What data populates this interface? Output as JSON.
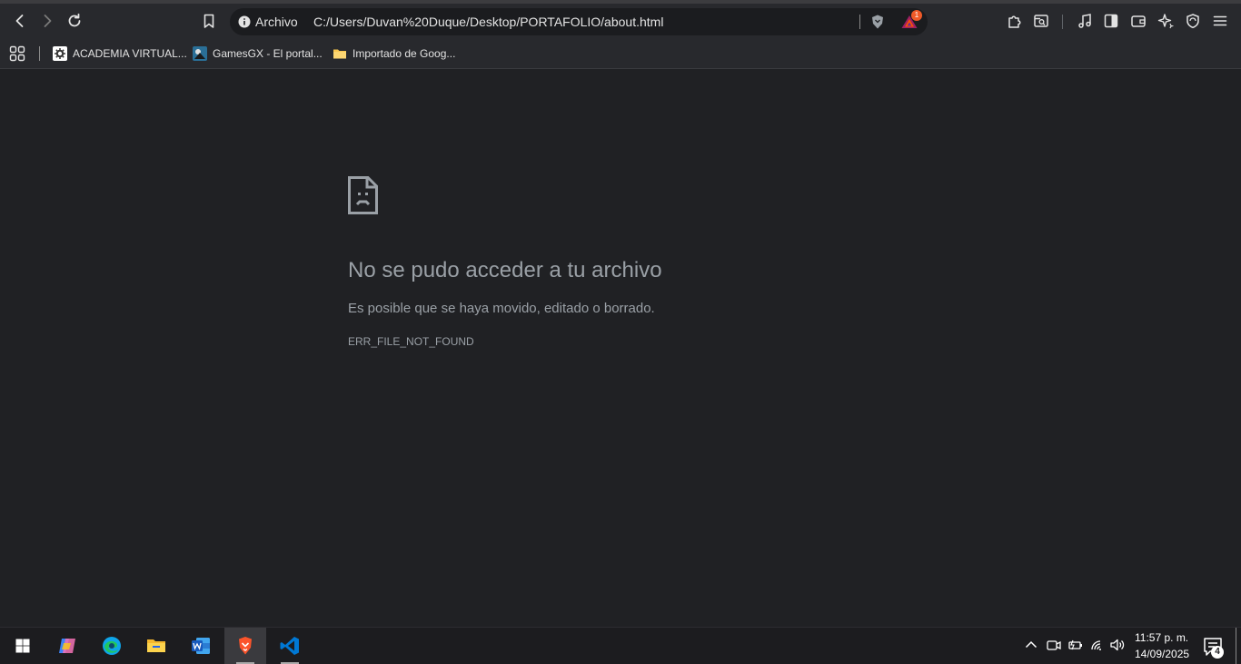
{
  "browser": {
    "url_chip": "Archivo",
    "url": "C:/Users/Duvan%20Duque/Desktop/PORTAFOLIO/about.html",
    "rewards_badge": "1"
  },
  "bookmarks": {
    "items": [
      {
        "label": "ACADEMIA VIRTUAL..."
      },
      {
        "label": "GamesGX - El portal..."
      },
      {
        "label": "Importado de Goog..."
      }
    ]
  },
  "error_page": {
    "title": "No se pudo acceder a tu archivo",
    "description": "Es posible que se haya movido, editado o borrado.",
    "code": "ERR_FILE_NOT_FOUND"
  },
  "taskbar": {
    "time": "11:57 p. m.",
    "date": "14/09/2025",
    "notification_count": "4"
  },
  "colors": {
    "page_bg": "#202124",
    "toolbar_bg": "#28292d",
    "error_text": "#9aa0a6",
    "brave_orange": "#fb542b",
    "vscode_blue": "#0078d4"
  }
}
